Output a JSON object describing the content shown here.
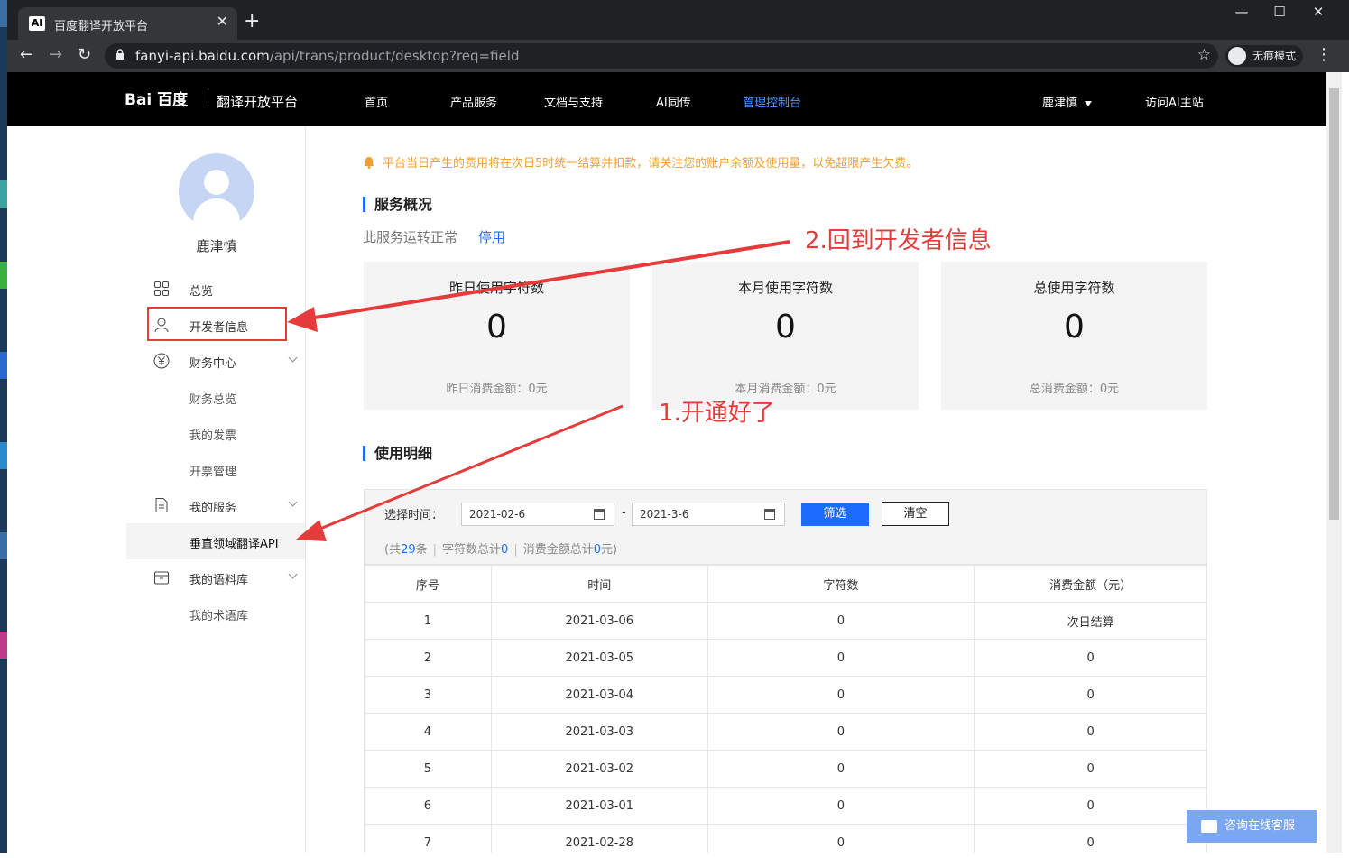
{
  "browser": {
    "tab_title": "百度翻译开放平台",
    "tab_favicon": "AI",
    "url_host": "fanyi-api.baidu.com",
    "url_path": "/api/trans/product/desktop?req=field",
    "incognito_label": "无痕模式"
  },
  "topnav": {
    "logo": "Bai 百度",
    "logo_sub": "翻译开放平台",
    "items": [
      "首页",
      "产品服务",
      "文档与支持",
      "AI同传",
      "管理控制台"
    ],
    "user": "鹿津慎",
    "visit_ai": "访问AI主站"
  },
  "sidebar": {
    "username": "鹿津慎",
    "items": [
      {
        "label": "总览",
        "icon": "grid-icon"
      },
      {
        "label": "开发者信息",
        "icon": "user-icon"
      },
      {
        "label": "财务中心",
        "icon": "yen-icon"
      },
      {
        "label": "财务总览"
      },
      {
        "label": "我的发票"
      },
      {
        "label": "开票管理"
      },
      {
        "label": "我的服务",
        "icon": "document-icon"
      },
      {
        "label": "垂直领域翻译API"
      },
      {
        "label": "我的语料库",
        "icon": "archive-icon"
      },
      {
        "label": "我的术语库"
      }
    ]
  },
  "main": {
    "notice": "平台当日产生的费用将在次日5时统一结算并扣款，请关注您的账户余额及使用量，以免超限产生欠费。",
    "overview_title": "服务概况",
    "service_status": "此服务运转正常",
    "disable_link": "停用",
    "stats": [
      {
        "label": "昨日使用字符数",
        "value": "0",
        "sub": "昨日消费金额：0元"
      },
      {
        "label": "本月使用字符数",
        "value": "0",
        "sub": "本月消费金额：0元"
      },
      {
        "label": "总使用字符数",
        "value": "0",
        "sub": "总消费金额：0元"
      }
    ],
    "usage_title": "使用明细",
    "filter": {
      "label": "选择时间：",
      "start": "2021-02-6",
      "end": "2021-3-6",
      "dash": "-",
      "filter_btn": "筛选",
      "clear_btn": "清空",
      "summary_prefix": "(共",
      "count": "29",
      "summary_count_unit": "条",
      "chars_label": "字符数总计",
      "chars_total": "0",
      "cost_label": "消费金额总计",
      "cost_total": "0",
      "summary_suffix": "元)"
    },
    "table": {
      "headers": [
        "序号",
        "时间",
        "字符数",
        "消费金额（元）"
      ],
      "rows": [
        [
          "1",
          "2021-03-06",
          "0",
          "次日结算"
        ],
        [
          "2",
          "2021-03-05",
          "0",
          "0"
        ],
        [
          "3",
          "2021-03-04",
          "0",
          "0"
        ],
        [
          "4",
          "2021-03-03",
          "0",
          "0"
        ],
        [
          "5",
          "2021-03-02",
          "0",
          "0"
        ],
        [
          "6",
          "2021-03-01",
          "0",
          "0"
        ],
        [
          "7",
          "2021-02-28",
          "0",
          "0"
        ]
      ]
    }
  },
  "annotations": {
    "back_to_dev": "2.回到开发者信息",
    "activated": "1.开通好了"
  },
  "chat_button": "咨询在线客服",
  "colors": {
    "accent": "#1e6cff",
    "annotation": "#e53b3b",
    "notice": "#f0a030"
  }
}
